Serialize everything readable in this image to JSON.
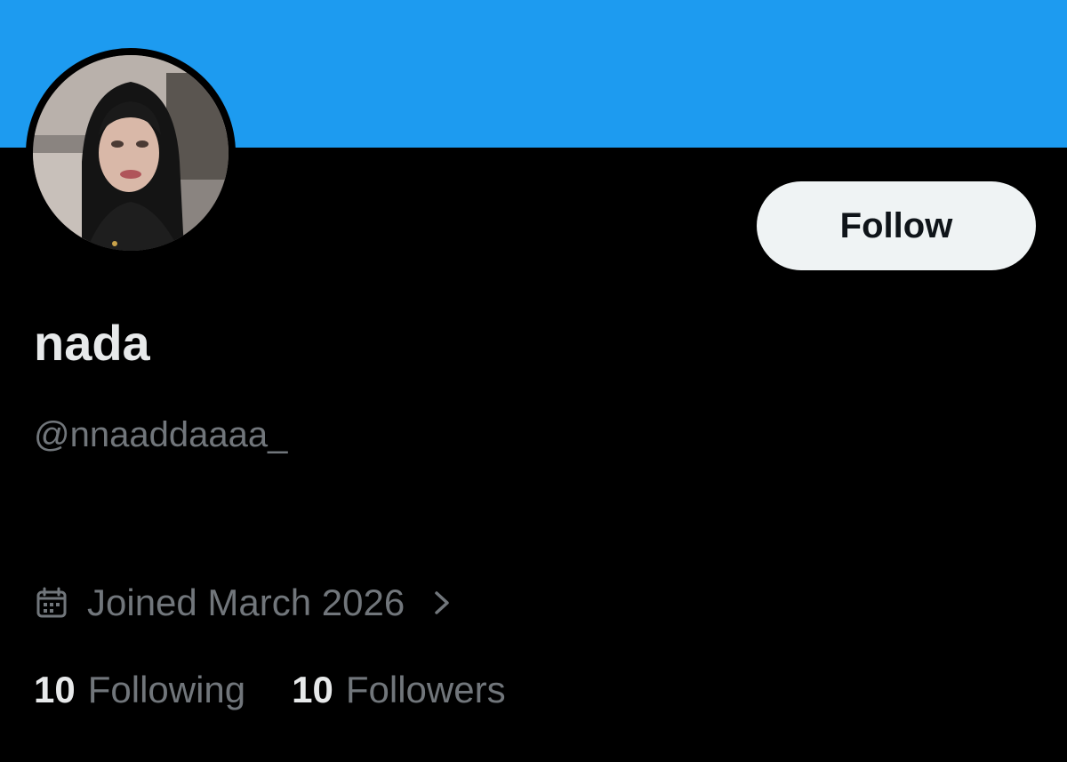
{
  "colors": {
    "banner": "#1d9bf0",
    "background": "#000000",
    "primary_text": "#e7e9ea",
    "secondary_text": "#71767b",
    "follow_button_bg": "#eff3f4",
    "follow_button_text": "#0f1419"
  },
  "profile": {
    "display_name": "nada",
    "handle": "@nnaaddaaaa_",
    "joined": "Joined March 2026",
    "joined_icon": "calendar-icon",
    "joined_chevron_icon": "chevron-right-icon"
  },
  "actions": {
    "follow_label": "Follow"
  },
  "stats": {
    "following": {
      "count": "10",
      "label": "Following"
    },
    "followers": {
      "count": "10",
      "label": "Followers"
    }
  }
}
